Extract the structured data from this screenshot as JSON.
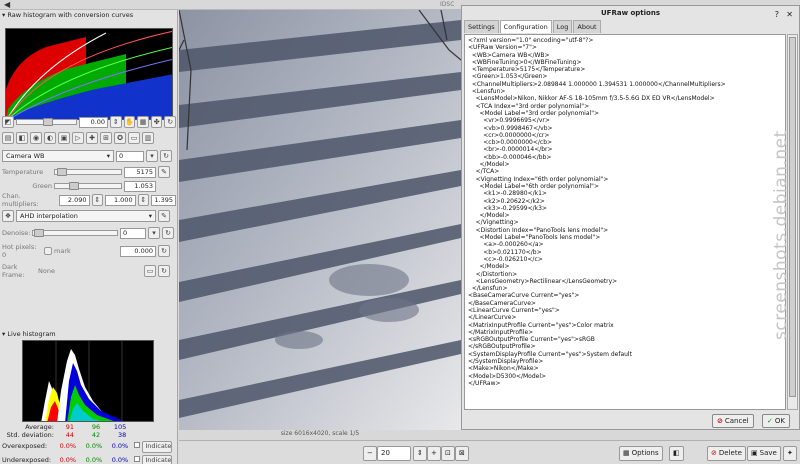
{
  "window": {
    "title": "IDSC",
    "menu_icon": "◀"
  },
  "left_panel": {
    "raw_histogram_header": "Raw histogram with conversion curves",
    "exposure_value": "0.00",
    "wb": {
      "mode": "Camera WB",
      "finetune": "0",
      "temperature_label": "Temperature",
      "temperature": "5175",
      "green_label": "Green",
      "green": "1.053",
      "multipliers_label": "Chan. multipliers:",
      "mult1": "2.090",
      "mult2": "1.000",
      "mult3": "1.395"
    },
    "interpolation": "AHD interpolation",
    "denoise_label": "Denoise:",
    "denoise_value": "0",
    "hotpixels_label": "Hot pixels: 0",
    "mark_label": "mark",
    "hotpixels_value": "0.000",
    "darkframe_label": "Dark Frame:",
    "darkframe_value": "None",
    "live_histogram_header": "Live histogram",
    "stats": {
      "average_label": "Average:",
      "average": [
        "91",
        "96",
        "105"
      ],
      "stddev_label": "Std. deviation:",
      "stddev": [
        "44",
        "42",
        "38"
      ],
      "over_label": "Overexposed:",
      "over": [
        "0.0%",
        "0.0%",
        "0.0%"
      ],
      "under_label": "Underexposed:",
      "under": [
        "0.0%",
        "0.0%",
        "0.0%"
      ],
      "indicate_label": "Indicate"
    }
  },
  "status_text": "size 6016x4020, scale 1/5",
  "dialog": {
    "title": "UFRaw options",
    "tabs": [
      "Settings",
      "Configuration",
      "Log",
      "About"
    ],
    "active_tab": 1,
    "xml_lines": [
      "<?xml version=\"1.0\" encoding=\"utf-8\"?>",
      "<UFRaw Version=\"7\">",
      "  <WB>Camera WB</WB>",
      "  <WBFineTuning>0</WBFineTuning>",
      "  <Temperature>5175</Temperature>",
      "  <Green>1.053</Green>",
      "  <ChannelMultipliers>2.089844 1.000000 1.394531 1.000000</ChannelMultipliers>",
      "  <Lensfun>",
      "    <LensModel>Nikon, Nikkor AF-S 18-105mm f/3.5-5.6G DX ED VR</LensModel>",
      "    <TCA Index=\"3rd order polynomial\">",
      "      <Model Label=\"3rd order polynomial\">",
      "        <vr>0.9996695</vr>",
      "        <vb>0.9998467</vb>",
      "        <cr>0.0000000</cr>",
      "        <cb>0.0000000</cb>",
      "        <br>-0.0000014</br>",
      "        <bb>-0.000046</bb>",
      "      </Model>",
      "    </TCA>",
      "    <Vignetting Index=\"6th order polynomial\">",
      "      <Model Label=\"6th order polynomial\">",
      "        <k1>-0.28980</k1>",
      "        <k2>0.20622</k2>",
      "        <k3>-0.29599</k3>",
      "      </Model>",
      "    </Vignetting>",
      "    <Distortion Index=\"PanoTools lens model\">",
      "      <Model Label=\"PanoTools lens model\">",
      "        <a>-0.000260</a>",
      "        <b>0.021170</b>",
      "        <c>-0.026210</c>",
      "      </Model>",
      "    </Distortion>",
      "    <LensGeometry>Rectilinear</LensGeometry>",
      "  </Lensfun>",
      "<BaseCameraCurve Current=\"yes\">",
      "</BaseCameraCurve>",
      "<LinearCurve Current=\"yes\">",
      "</LinearCurve>",
      "<MatrixInputProfile Current=\"yes\">Color matrix",
      "</MatrixInputProfile>",
      "<sRGBOutputProfile Current=\"yes\">sRGB",
      "</sRGBOutputProfile>",
      "<SystemDisplayProfile Current=\"yes\">System default",
      "</SystemDisplayProfile>",
      "<Make>Nikon</Make>",
      "<Model>D5300</Model>",
      "</UFRaw>"
    ],
    "cancel_label": "Cancel",
    "ok_label": "OK"
  },
  "bottom": {
    "zoom_value": "20",
    "options_label": "Options",
    "delete_label": "Delete",
    "save_label": "Save"
  },
  "watermark": "screenshots.debian.net"
}
